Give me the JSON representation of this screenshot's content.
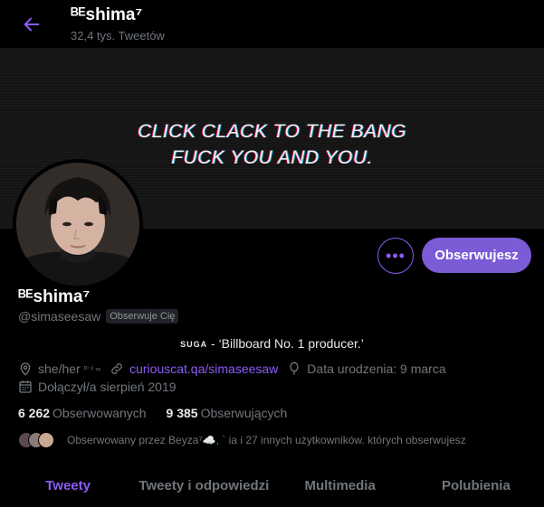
{
  "header": {
    "display_name": "ᴮᴱshima⁷",
    "tweet_count": "32,4 tys. Tweetów"
  },
  "banner": {
    "line1": "CLICK CLACK TO THE BANG",
    "line2": "FUCK YOU AND YOU."
  },
  "actions": {
    "more_label": "•••",
    "follow_label": "Obserwujesz"
  },
  "profile": {
    "display_name": "ᴮᴱshima⁷",
    "handle": "@simaseesaw",
    "follows_you": "Obserwuje Cię",
    "bio_tag": "SUGA",
    "bio_text": " - ‘Billboard No. 1 producer.’",
    "location": "she/her",
    "location_sup": "ᴰ⁻² ∞",
    "website": "curiouscat.qa/simaseesaw",
    "birthday": "Data urodzenia: 9 marca",
    "joined": "Dołączył/a sierpień 2019"
  },
  "stats": {
    "following_count": "6 262",
    "following_label": "Obserwowanych",
    "followers_count": "9 385",
    "followers_label": "Obserwujących"
  },
  "followed_by": {
    "text": "Obserwowany przez Beyza⁷☁️, ` ia i 27 innych użytkowników. których obserwujesz"
  },
  "tabs": [
    {
      "label": "Tweety",
      "active": true
    },
    {
      "label": "Tweety i odpowiedzi",
      "active": false
    },
    {
      "label": "Multimedia",
      "active": false
    },
    {
      "label": "Polubienia",
      "active": false
    }
  ],
  "colors": {
    "accent": "#8b5cf6",
    "follow_button": "#7b5bd6",
    "background": "#000000",
    "muted_text": "#71767b"
  },
  "icons": {
    "back": "arrow-left-icon",
    "location": "location-pin-icon",
    "website": "link-icon",
    "birthday": "balloon-icon",
    "joined": "calendar-icon"
  }
}
